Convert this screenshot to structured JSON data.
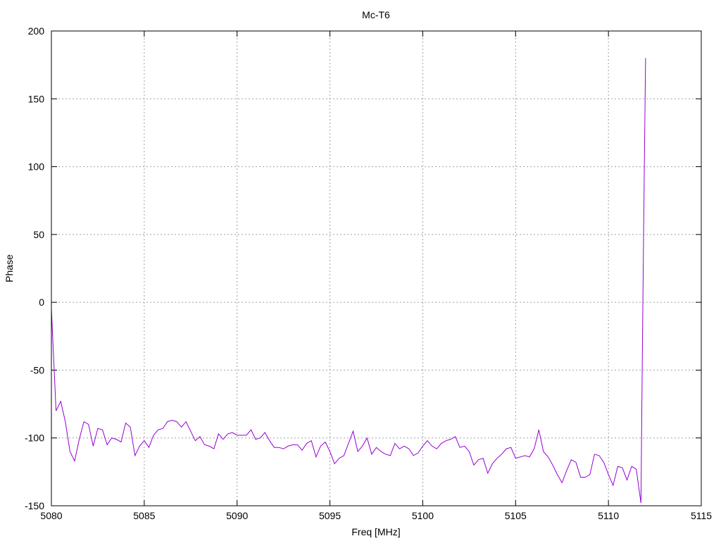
{
  "chart_data": {
    "type": "line",
    "title": "Mc-T6",
    "xlabel": "Freq [MHz]",
    "ylabel": "Phase",
    "xlim": [
      5080,
      5115
    ],
    "ylim": [
      -150,
      200
    ],
    "xticks": [
      5080,
      5085,
      5090,
      5095,
      5100,
      5105,
      5110,
      5115
    ],
    "yticks": [
      -150,
      -100,
      -50,
      0,
      50,
      100,
      150,
      200
    ],
    "grid": true,
    "line_color": "#9400d3",
    "series": [
      {
        "x": [
          5080.0,
          5080.25,
          5080.5,
          5080.75,
          5081.0,
          5081.25,
          5081.5,
          5081.75,
          5082.0,
          5082.25,
          5082.5,
          5082.75,
          5083.0,
          5083.25,
          5083.5,
          5083.75,
          5084.0,
          5084.25,
          5084.5,
          5084.75,
          5085.0,
          5085.25,
          5085.5,
          5085.75,
          5086.0,
          5086.25,
          5086.5,
          5086.75,
          5087.0,
          5087.25,
          5087.5,
          5087.75,
          5088.0,
          5088.25,
          5088.5,
          5088.75,
          5089.0,
          5089.25,
          5089.5,
          5089.75,
          5090.0,
          5090.25,
          5090.5,
          5090.75,
          5091.0,
          5091.25,
          5091.5,
          5091.75,
          5092.0,
          5092.25,
          5092.5,
          5092.75,
          5093.0,
          5093.25,
          5093.5,
          5093.75,
          5094.0,
          5094.25,
          5094.5,
          5094.75,
          5095.0,
          5095.25,
          5095.5,
          5095.75,
          5096.0,
          5096.25,
          5096.5,
          5096.75,
          5097.0,
          5097.25,
          5097.5,
          5097.75,
          5098.0,
          5098.25,
          5098.5,
          5098.75,
          5099.0,
          5099.25,
          5099.5,
          5099.75,
          5100.0,
          5100.25,
          5100.5,
          5100.75,
          5101.0,
          5101.25,
          5101.5,
          5101.75,
          5102.0,
          5102.25,
          5102.5,
          5102.75,
          5103.0,
          5103.25,
          5103.5,
          5103.75,
          5104.0,
          5104.25,
          5104.5,
          5104.75,
          5105.0,
          5105.25,
          5105.5,
          5105.75,
          5106.0,
          5106.25,
          5106.5,
          5106.75,
          5107.0,
          5107.25,
          5107.5,
          5107.75,
          5108.0,
          5108.25,
          5108.5,
          5108.75,
          5109.0,
          5109.25,
          5109.5,
          5109.75,
          5110.0,
          5110.25,
          5110.5,
          5110.75,
          5111.0,
          5111.25,
          5111.5,
          5111.75,
          5111.8,
          5111.9,
          5112.0
        ],
        "y": [
          -5,
          -80,
          -73,
          -88,
          -110,
          -117,
          -101,
          -88,
          -90,
          -106,
          -93,
          -94,
          -105,
          -100,
          -101,
          -103,
          -89,
          -92,
          -113,
          -106,
          -102,
          -107,
          -98,
          -94,
          -93,
          -88,
          -87,
          -88,
          -92,
          -88,
          -95,
          -102,
          -99,
          -105,
          -106,
          -108,
          -97,
          -101,
          -97,
          -96,
          -98,
          -98,
          -98,
          -94,
          -101,
          -100,
          -96,
          -102,
          -107,
          -107,
          -108,
          -106,
          -105,
          -105,
          -109,
          -104,
          -102,
          -114,
          -106,
          -103,
          -110,
          -119,
          -115,
          -113,
          -104,
          -95,
          -110,
          -106,
          -100,
          -112,
          -107,
          -110,
          -112,
          -113,
          -104,
          -108,
          -106,
          -108,
          -113,
          -111,
          -106,
          -102,
          -106,
          -108,
          -104,
          -102,
          -101,
          -99,
          -107,
          -106,
          -110,
          -120,
          -116,
          -115,
          -126,
          -119,
          -115,
          -112,
          -108,
          -107,
          -115,
          -114,
          -113,
          -114,
          -108,
          -94,
          -110,
          -114,
          -120,
          -127,
          -133,
          -124,
          -116,
          -118,
          -129,
          -129,
          -127,
          -112,
          -113,
          -118,
          -127,
          -135,
          -121,
          -122,
          -131,
          -121,
          -123,
          -148,
          -75,
          60,
          180
        ]
      }
    ]
  }
}
